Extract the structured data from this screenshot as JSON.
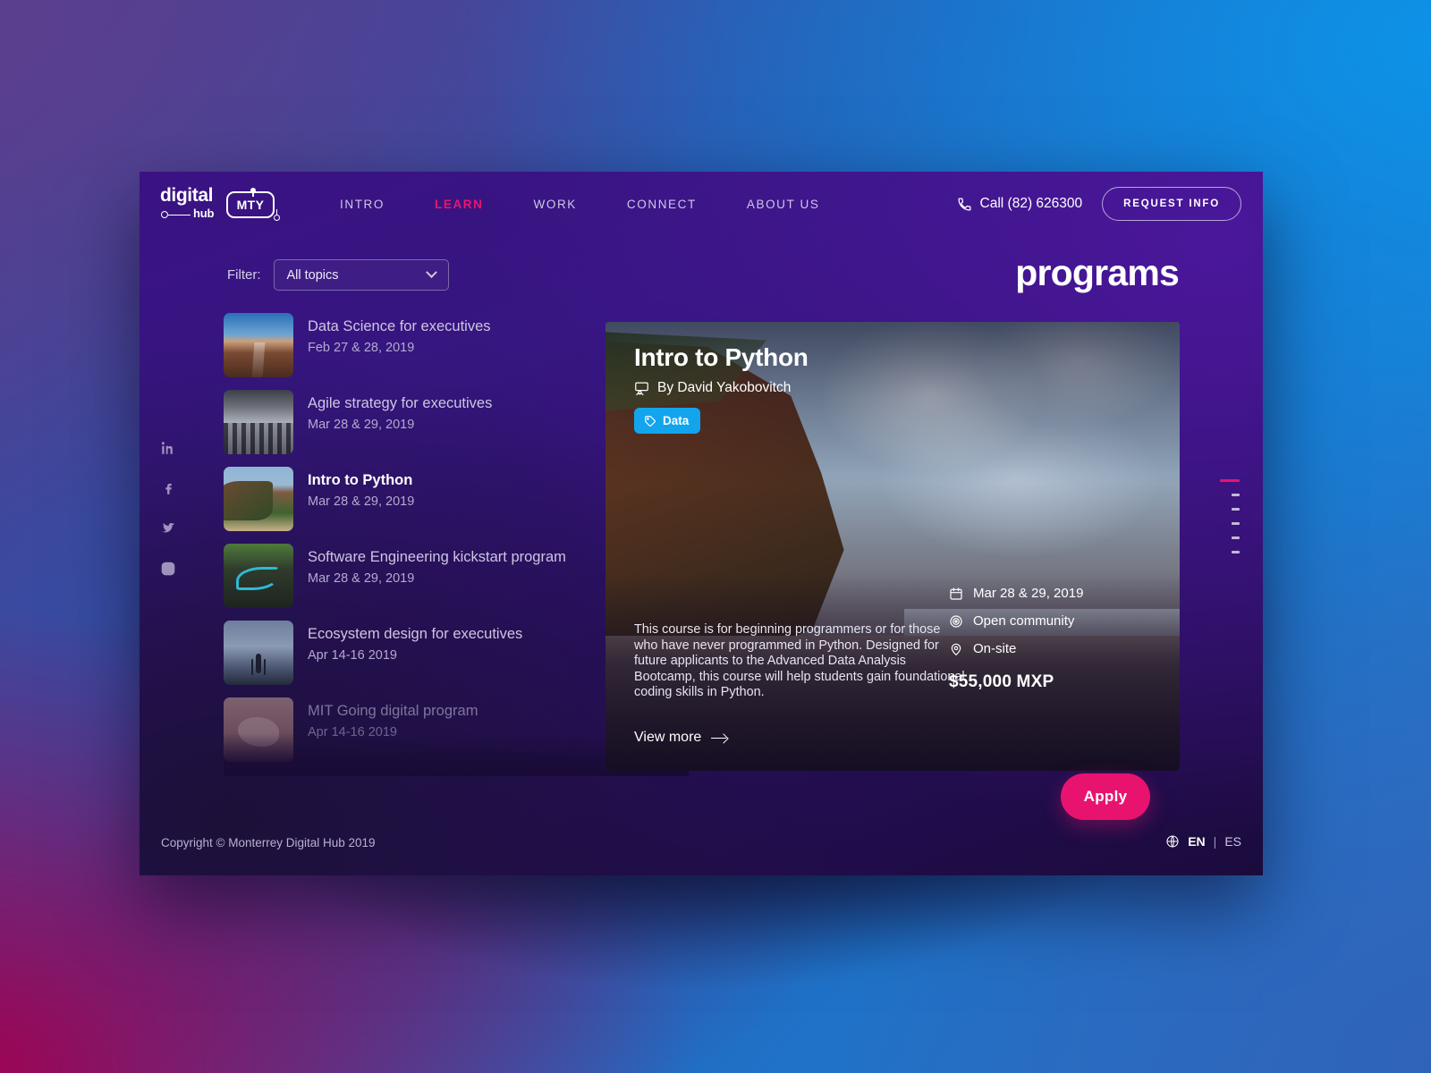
{
  "header": {
    "logo": {
      "word": "digital",
      "sub": "hub",
      "badge": "MTY"
    },
    "nav": [
      {
        "label": "INTRO",
        "active": false
      },
      {
        "label": "LEARN",
        "active": true
      },
      {
        "label": "WORK",
        "active": false
      },
      {
        "label": "CONNECT",
        "active": false
      },
      {
        "label": "ABOUT US",
        "active": false
      }
    ],
    "call_label": "Call (82) 626300",
    "request_info_label": "REQUEST INFO"
  },
  "filter": {
    "label": "Filter:",
    "selected": "All topics",
    "options": [
      "All topics"
    ]
  },
  "page_title": "programs",
  "social": [
    {
      "name": "linkedin",
      "label": "in"
    },
    {
      "name": "facebook",
      "label": "f"
    },
    {
      "name": "twitter",
      "label": "twitter"
    },
    {
      "name": "instagram",
      "label": "instagram"
    }
  ],
  "programs": [
    {
      "title": "Data Science for executives",
      "date": "Feb 27 & 28, 2019"
    },
    {
      "title": "Agile strategy for executives",
      "date": "Mar 28 & 29, 2019"
    },
    {
      "title": "Intro to Python",
      "date": "Mar 28 & 29, 2019"
    },
    {
      "title": "Software Engineering kickstart program",
      "date": "Mar 28 & 29, 2019"
    },
    {
      "title": "Ecosystem design for executives",
      "date": "Apr 14-16 2019"
    },
    {
      "title": "MIT Going digital program",
      "date": "Apr 14-16 2019"
    }
  ],
  "feature": {
    "title": "Intro to Python",
    "author": "By David Yakobovitch",
    "tag": "Data",
    "description": "This course is for beginning programmers or for those who have never programmed in Python. Designed for future applicants to the Advanced Data Analysis Bootcamp, this course will help students gain foundational coding skills in Python.",
    "view_more": "View more",
    "meta": {
      "date": "Mar 28 & 29, 2019",
      "audience": "Open community",
      "mode": "On-site",
      "price": "$55,000 MXP"
    },
    "apply_label": "Apply"
  },
  "pagination": {
    "total": 6,
    "active_index": 0
  },
  "footer": {
    "copyright": "Copyright © Monterrey Digital Hub 2019",
    "lang_en": "EN",
    "lang_sep": "|",
    "lang_es": "ES"
  },
  "colors": {
    "accent_pink": "#e8136f",
    "tag_blue": "#12a5ee",
    "panel_purple": "#35167f"
  }
}
